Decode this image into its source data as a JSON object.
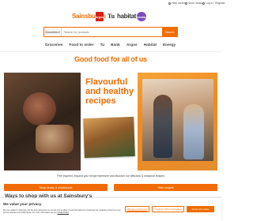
{
  "utility": {
    "help": "Help centre",
    "stores": "Store locator",
    "login": "Log in / Register"
  },
  "brands": {
    "sainsburys": "Sainsbury's",
    "argos": "Argos",
    "tu": "Tu",
    "habitat": "habitat",
    "nectar": "nectar"
  },
  "search": {
    "category": "Groceries",
    "placeholder": "Search for products",
    "button": "Search"
  },
  "nav": {
    "items": [
      "Groceries",
      "Food to order",
      "Tu",
      "Bank",
      "Argos",
      "Habitat",
      "Energy"
    ]
  },
  "hero": {
    "headline": "Good food for all of us",
    "title_line1": "Flavourful",
    "title_line2": "and healthy",
    "title_line3": "recipes",
    "subtext": "Feel inspired, expand your recipe repertoire and discover our delicious & seasonal recipes",
    "cta_left": "Shop hearty & wholesome",
    "cta_right": "View recipes"
  },
  "ways": {
    "heading": "Ways to shop with us at Sainsbury's"
  },
  "cookie": {
    "title": "We value your privacy",
    "body": "We use cookies to help give you the best experience on our site and to allow us and third parties to customise the marketing content you see across websites and social media. For more information see our ",
    "link": "Cookie Policy",
    "manage": "Manage preferences",
    "continue": "Continue without accepting",
    "accept": "Accept all cookies"
  },
  "colors": {
    "brand_orange": "#f06c00",
    "text_dark": "#404040"
  }
}
